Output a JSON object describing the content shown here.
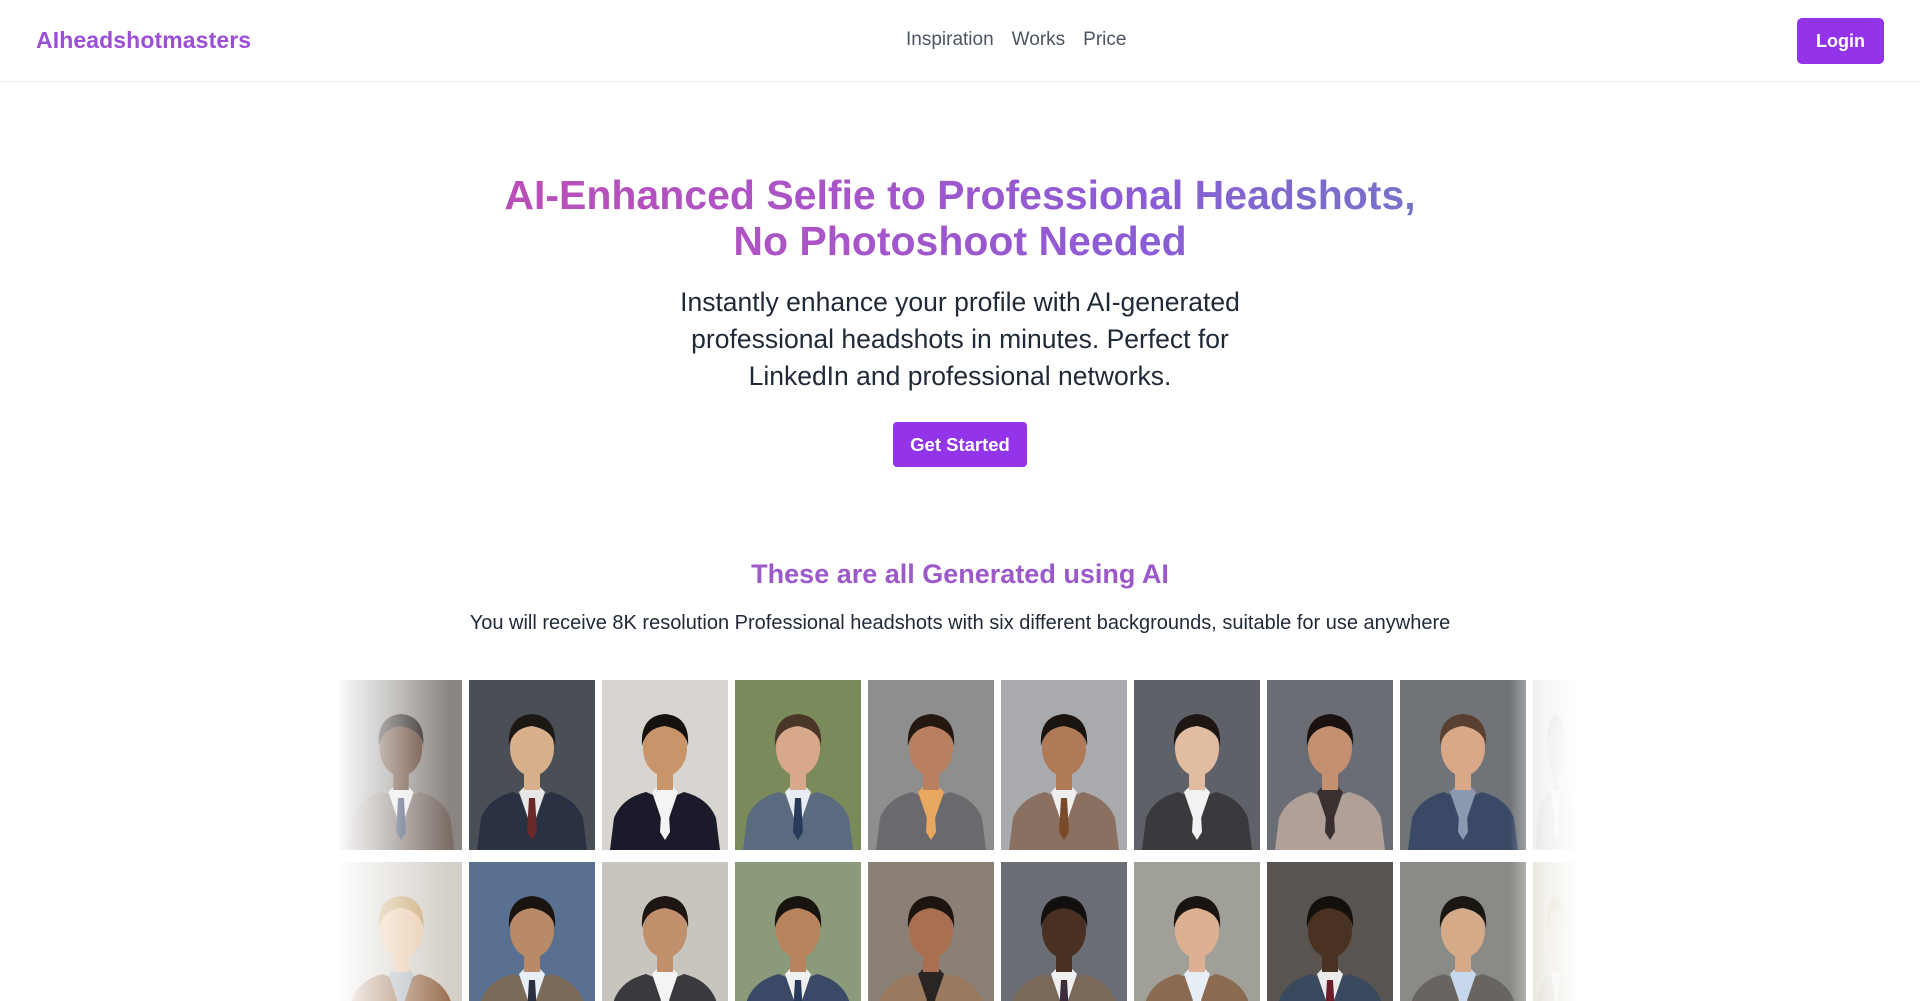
{
  "header": {
    "logo": "AIheadshotmasters",
    "nav": [
      "Inspiration",
      "Works",
      "Price"
    ],
    "login_label": "Login"
  },
  "hero": {
    "title_line1": "AI-Enhanced Selfie to Professional Headshots,",
    "title_line2": "No Photoshoot Needed",
    "subtitle_line1": "Instantly enhance your profile with AI-generated",
    "subtitle_line2": "professional headshots in minutes. Perfect for",
    "subtitle_line3": "LinkedIn and professional networks.",
    "cta_label": "Get Started"
  },
  "gallery": {
    "title": "These are all Generated using AI",
    "subtitle": "You will receive 8K resolution Professional headshots with six different backgrounds, suitable for use anywhere",
    "row1": [
      {
        "bg": "#8a8580",
        "skin": "#5a3a28",
        "hair": "#1a1410",
        "suit": "#7a6e66",
        "shirt": "#e8e8e8",
        "tie": "#3a4a6a"
      },
      {
        "bg": "#4a4e55",
        "skin": "#d9b08c",
        "hair": "#1c1814",
        "suit": "#2a3142",
        "shirt": "#e6e6e6",
        "tie": "#6a2a2a"
      },
      {
        "bg": "#d8d4cf",
        "skin": "#c8946a",
        "hair": "#15110e",
        "suit": "#1a1a2a",
        "shirt": "#f4f4f4",
        "tie": "#f4f4f4"
      },
      {
        "bg": "#7a8a5a",
        "skin": "#d8a88a",
        "hair": "#4a3626",
        "suit": "#5a6b80",
        "shirt": "#e8ecf2",
        "tie": "#2a3a5a"
      },
      {
        "bg": "#8e8e8e",
        "skin": "#b88060",
        "hair": "#241810",
        "suit": "#6a6a6e",
        "shirt": "#e8a860",
        "tie": "#e8a860"
      },
      {
        "bg": "#a8aaae",
        "skin": "#b07a58",
        "hair": "#1a1410",
        "suit": "#8a7060",
        "shirt": "#efefef",
        "tie": "#7a4a2a"
      },
      {
        "bg": "#5e6268",
        "skin": "#e2bca0",
        "hair": "#1e1612",
        "suit": "#3a3a3e",
        "shirt": "#f2f2f2",
        "tie": "#f2f2f2"
      },
      {
        "bg": "#6a6e74",
        "skin": "#c49070",
        "hair": "#1a1210",
        "suit": "#b0a098",
        "shirt": "#3a3030",
        "tie": "#3a3030"
      },
      {
        "bg": "#707478",
        "skin": "#d8a888",
        "hair": "#5a4030",
        "suit": "#3a4a66",
        "shirt": "#8a98b0",
        "tie": "#8a98b0"
      },
      {
        "bg": "#e2e2e2",
        "skin": "#d8d0c8",
        "hair": "#c8c0b8",
        "suit": "#d0d0d0",
        "shirt": "#f0f0f0",
        "tie": "#f0f0f0"
      }
    ],
    "row2": [
      {
        "bg": "#d4cfc8",
        "skin": "#e8c8a8",
        "hair": "#c8a870",
        "suit": "#9a7050",
        "shirt": "#b0b8c0",
        "tie": "#b0b8c0"
      },
      {
        "bg": "#5a7090",
        "skin": "#b88a68",
        "hair": "#1a1410",
        "suit": "#7a6a58",
        "shirt": "#e8eef6",
        "tie": "#2a3040"
      },
      {
        "bg": "#c8c4be",
        "skin": "#c0906c",
        "hair": "#1e1612",
        "suit": "#3a3a3e",
        "shirt": "#f4f4f4",
        "tie": "#f4f4f4"
      },
      {
        "bg": "#8a9a7a",
        "skin": "#b8845e",
        "hair": "#1a1410",
        "suit": "#3a4a66",
        "shirt": "#f0f0f0",
        "tie": "#2a3a5a"
      },
      {
        "bg": "#8a8076",
        "skin": "#a87050",
        "hair": "#1e1410",
        "suit": "#9a7a5e",
        "shirt": "#2a2422",
        "tie": "#2a2422"
      },
      {
        "bg": "#6a6e74",
        "skin": "#4a3020",
        "hair": "#12100e",
        "suit": "#7a6858",
        "shirt": "#f0f0f0",
        "tie": "#3a2a3a"
      },
      {
        "bg": "#a0a098",
        "skin": "#dcb090",
        "hair": "#1a1410",
        "suit": "#8a6a50",
        "shirt": "#e8eef6",
        "tie": "#e8eef6"
      },
      {
        "bg": "#5a5450",
        "skin": "#4a3222",
        "hair": "#14100c",
        "suit": "#3a4a5e",
        "shirt": "#eaeaea",
        "tie": "#6a1e2a"
      },
      {
        "bg": "#8a8a86",
        "skin": "#d4aa88",
        "hair": "#1a1612",
        "suit": "#6a6460",
        "shirt": "#c8d8ec",
        "tie": "#c8d8ec"
      },
      {
        "bg": "#d8d2c0",
        "skin": "#d8c8b0",
        "hair": "#c8b890",
        "suit": "#c8c0b0",
        "shirt": "#e8e4dc",
        "tie": "#e8e4dc"
      }
    ]
  }
}
